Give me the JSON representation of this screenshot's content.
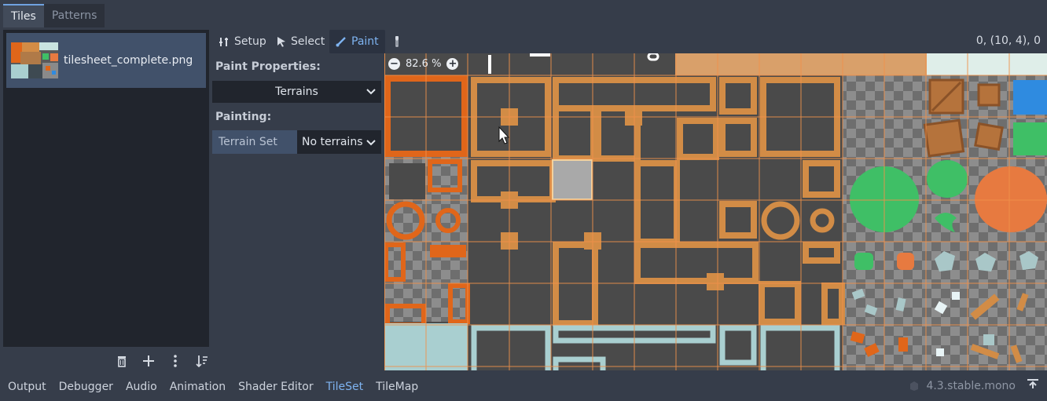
{
  "tabs": [
    {
      "label": "Tiles",
      "active": true
    },
    {
      "label": "Patterns",
      "active": false
    }
  ],
  "sources": [
    {
      "name": "tilesheet_complete.png"
    }
  ],
  "toolbar": {
    "setup": "Setup",
    "select": "Select",
    "paint": "Paint",
    "picker_icon": "eyedropper-icon",
    "coords": "0, (10, 4), 0"
  },
  "properties": {
    "paint_properties_title": "Paint Properties:",
    "property_select": "Terrains",
    "painting_title": "Painting:",
    "terrain_set_label": "Terrain Set",
    "terrain_set_value": "No terrains"
  },
  "zoom": {
    "level": "82.6 %"
  },
  "bottom_tabs": [
    {
      "label": "Output",
      "active": false
    },
    {
      "label": "Debugger",
      "active": false
    },
    {
      "label": "Audio",
      "active": false
    },
    {
      "label": "Animation",
      "active": false
    },
    {
      "label": "Shader Editor",
      "active": false
    },
    {
      "label": "TileSet",
      "active": true
    },
    {
      "label": "TileMap",
      "active": false
    }
  ],
  "version": "4.3.stable.mono",
  "colors": {
    "accent": "#6fa2e0",
    "grid": "#e88a3a",
    "orange_frame": "#e0661a",
    "wood": "#d28c46",
    "dark_tile": "#4a4a4a",
    "teal_tile": "#a9cfd0",
    "green_bush": "#3fbf66",
    "orange_bush": "#e77a40"
  }
}
